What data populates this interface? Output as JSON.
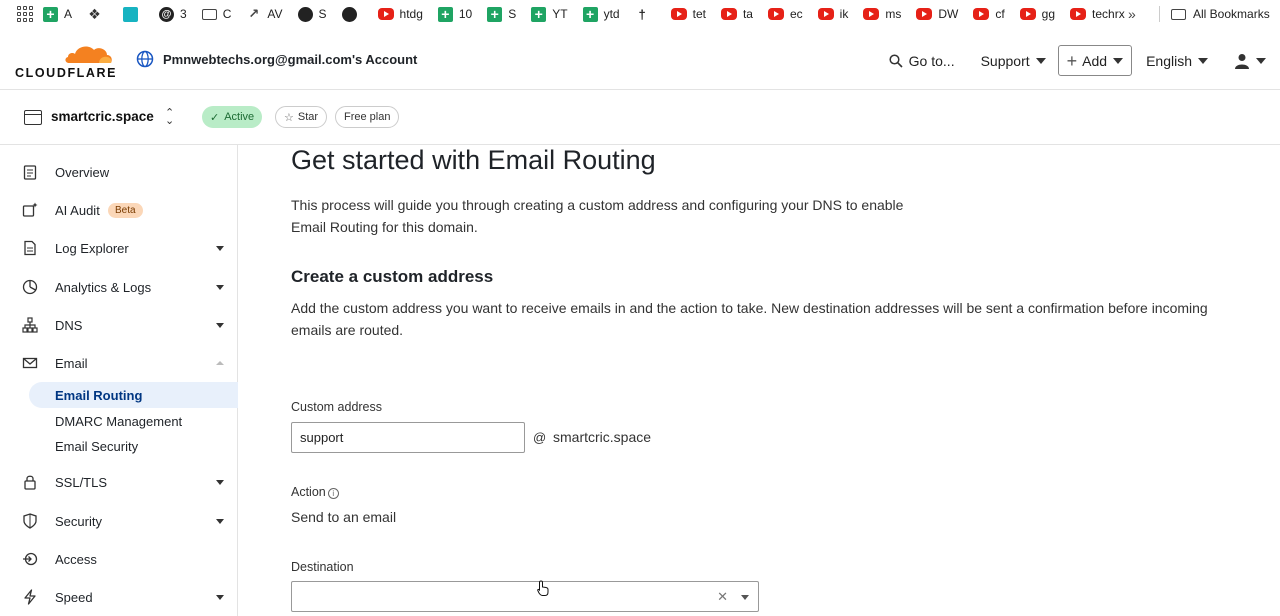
{
  "bookmarks": [
    {
      "icon": "sheets-icon",
      "label": "A"
    },
    {
      "icon": "puzzle-icon",
      "label": ""
    },
    {
      "icon": "teal-app-icon",
      "label": ""
    },
    {
      "icon": "threads-icon",
      "label": "3"
    },
    {
      "icon": "folder-icon",
      "label": "C"
    },
    {
      "icon": "trend-icon",
      "label": "AV"
    },
    {
      "icon": "circle-icon",
      "label": "S"
    },
    {
      "icon": "github-icon",
      "label": ""
    },
    {
      "icon": "youtube-icon",
      "label": "htdg"
    },
    {
      "icon": "sheets-icon",
      "label": "10"
    },
    {
      "icon": "sheets-icon",
      "label": "S"
    },
    {
      "icon": "sheets-icon",
      "label": "YT"
    },
    {
      "icon": "sheets-icon",
      "label": "ytd"
    },
    {
      "icon": "pin-icon",
      "label": ""
    },
    {
      "icon": "youtube-icon",
      "label": "tet"
    },
    {
      "icon": "youtube-icon",
      "label": "ta"
    },
    {
      "icon": "youtube-icon",
      "label": "ec"
    },
    {
      "icon": "youtube-icon",
      "label": "ik"
    },
    {
      "icon": "youtube-icon",
      "label": "ms"
    },
    {
      "icon": "youtube-icon",
      "label": "DW"
    },
    {
      "icon": "youtube-icon",
      "label": "cf"
    },
    {
      "icon": "youtube-icon",
      "label": "gg"
    },
    {
      "icon": "youtube-icon",
      "label": "techrx"
    }
  ],
  "bookmarks_more": "»",
  "all_bookmarks": "All Bookmarks",
  "header": {
    "logo_text": "CLOUDFLARE",
    "account": "Pmnwebtechs.org@gmail.com's Account",
    "goto": "Go to...",
    "support": "Support",
    "add": "Add",
    "language": "English"
  },
  "zone": {
    "name": "smartcric.space",
    "status": "Active",
    "star": "Star",
    "plan": "Free plan"
  },
  "sidebar": {
    "items": [
      {
        "label": "Overview",
        "icon": "clipboard-icon"
      },
      {
        "label": "AI Audit",
        "icon": "sparkle-icon",
        "badge": "Beta"
      },
      {
        "label": "Log Explorer",
        "icon": "document-icon"
      },
      {
        "label": "Analytics & Logs",
        "icon": "pie-chart-icon"
      },
      {
        "label": "DNS",
        "icon": "network-icon"
      },
      {
        "label": "Email",
        "icon": "envelope-icon"
      },
      {
        "label": "SSL/TLS",
        "icon": "lock-icon"
      },
      {
        "label": "Security",
        "icon": "shield-icon"
      },
      {
        "label": "Access",
        "icon": "access-icon"
      },
      {
        "label": "Speed",
        "icon": "lightning-icon"
      }
    ],
    "email_sub": [
      "Email Routing",
      "DMARC Management",
      "Email Security"
    ]
  },
  "main": {
    "title": "Get started with Email Routing",
    "intro": "This process will guide you through creating a custom address and configuring your DNS to enable Email Routing for this domain.",
    "section_title": "Create a custom address",
    "section_desc": "Add the custom address you want to receive emails in and the action to take. New destination addresses will be sent a confirmation before incoming emails are routed.",
    "custom_address_label": "Custom address",
    "custom_address_value": "support",
    "at": "@",
    "domain": "smartcric.space",
    "action_label": "Action",
    "action_value": "Send to an email",
    "destination_label": "Destination",
    "destination_value": ""
  },
  "colors": {
    "cloudflare_orange": "#f48120",
    "active_bg": "#b9ecc7",
    "beta_bg": "#fbd7b8",
    "nav_active_bg": "#e8f0fb"
  }
}
